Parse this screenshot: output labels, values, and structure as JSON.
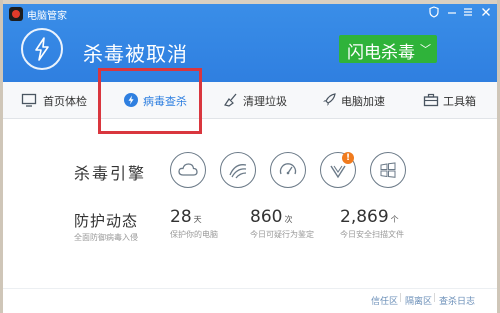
{
  "window": {
    "title": "电脑管家",
    "controls": [
      "shield-icon",
      "minimize-icon",
      "menu-icon",
      "close-icon"
    ]
  },
  "header": {
    "status_text": "杀毒被取消",
    "action_button": "闪电杀毒",
    "colors": {
      "header_bg": "#2f7fe0",
      "action_bg": "#2fb33a",
      "highlight": "#d9363e"
    }
  },
  "nav": {
    "items": [
      {
        "label": "首页体检",
        "icon": "monitor-icon"
      },
      {
        "label": "病毒查杀",
        "icon": "lightning-shield-icon",
        "active": true
      },
      {
        "label": "清理垃圾",
        "icon": "broom-icon"
      },
      {
        "label": "电脑加速",
        "icon": "rocket-icon"
      },
      {
        "label": "工具箱",
        "icon": "toolbox-icon"
      }
    ]
  },
  "engines": {
    "label": "杀毒引擎",
    "items": [
      "cloud-engine-icon",
      "wave-engine-icon",
      "gauge-engine-icon",
      "signal-engine-icon",
      "windows-engine-icon"
    ],
    "warning_badge": "!"
  },
  "defense": {
    "label": "防护动态",
    "subtitle": "全面防御病毒入侵",
    "stats": [
      {
        "value": "28",
        "unit": "天",
        "desc": "保护你的电脑"
      },
      {
        "value": "860",
        "unit": "次",
        "desc": "今日可疑行为鉴定"
      },
      {
        "value": "2,869",
        "unit": "个",
        "desc": "今日安全扫描文件"
      }
    ]
  },
  "footer": {
    "links": [
      "信任区",
      "隔离区",
      "查杀日志"
    ]
  }
}
